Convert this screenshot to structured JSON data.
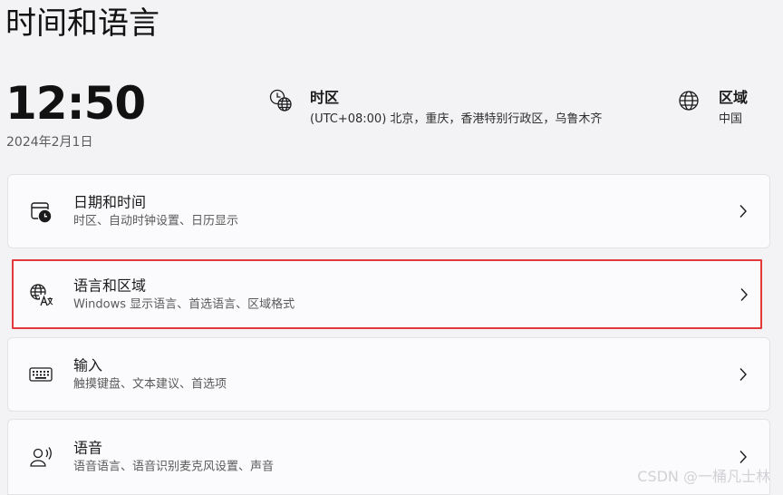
{
  "page_title": "时间和语言",
  "clock": {
    "time": "12:50",
    "date": "2024年2月1日"
  },
  "time_zone": {
    "title": "时区",
    "value": "(UTC+08:00) 北京，重庆，香港特别行政区，乌鲁木齐",
    "icon": "timezone-globe-icon"
  },
  "region": {
    "title": "区域",
    "value": "中国",
    "icon": "globe-icon"
  },
  "cards": [
    {
      "title": "日期和时间",
      "subtitle": "时区、自动时钟设置、日历显示",
      "icon": "calendar-clock-icon"
    },
    {
      "title": "语言和区域",
      "subtitle": "Windows 显示语言、首选语言、区域格式",
      "icon": "language-icon",
      "highlighted": true,
      "highlight_color": "#e23a3a"
    },
    {
      "title": "输入",
      "subtitle": "触摸键盘、文本建议、首选项",
      "icon": "keyboard-icon"
    },
    {
      "title": "语音",
      "subtitle": "语音语言、语音识别麦克风设置、声音",
      "icon": "speech-icon"
    }
  ],
  "watermark": "CSDN @一桶凡士林",
  "colors": {
    "background": "#f3f3f5",
    "card": "#fbfbfd",
    "card_border": "#e3e3e6",
    "highlight": "#e23a3a"
  }
}
